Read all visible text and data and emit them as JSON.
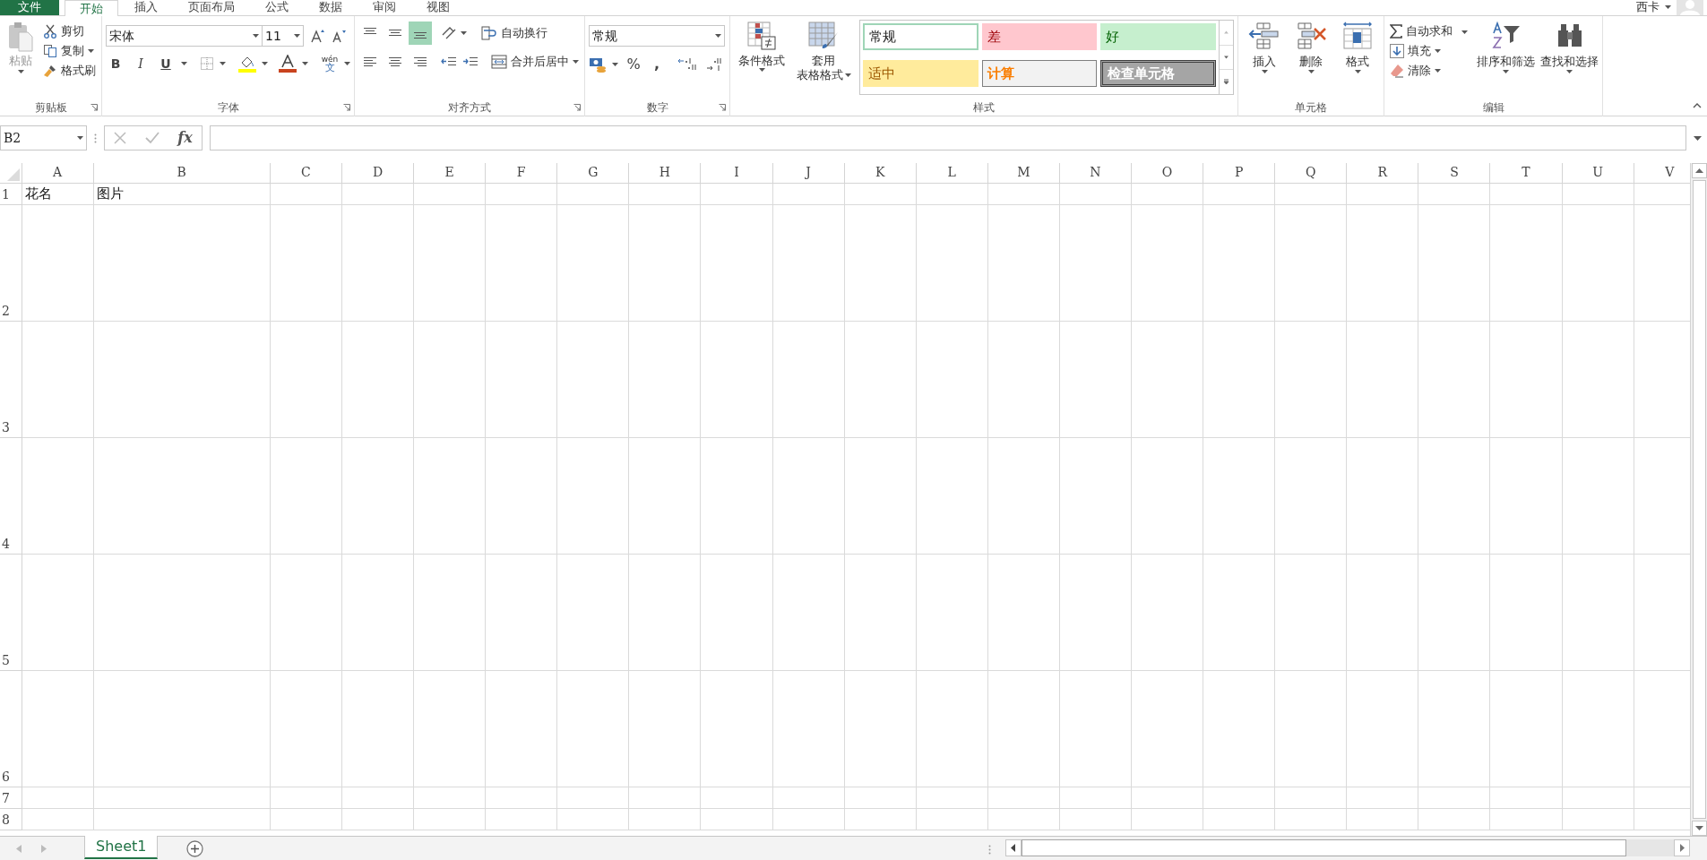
{
  "menu_tabs": [
    {
      "label": "文件",
      "kind": "file",
      "selected": false
    },
    {
      "label": "开始",
      "kind": "tab",
      "selected": true
    },
    {
      "label": "插入",
      "kind": "tab",
      "selected": false
    },
    {
      "label": "页面布局",
      "kind": "tab",
      "selected": false
    },
    {
      "label": "公式",
      "kind": "tab",
      "selected": false
    },
    {
      "label": "数据",
      "kind": "tab",
      "selected": false
    },
    {
      "label": "审阅",
      "kind": "tab",
      "selected": false
    },
    {
      "label": "视图",
      "kind": "tab",
      "selected": false
    }
  ],
  "account": {
    "name": "西卡"
  },
  "ribbon": {
    "clipboard": {
      "label": "剪贴板",
      "paste": "粘贴",
      "cut": "剪切",
      "copy": "复制",
      "format_painter": "格式刷"
    },
    "font": {
      "label": "字体",
      "font_name": "宋体",
      "font_size": "11",
      "bold": "B",
      "italic": "I",
      "underline": "U",
      "phonetic_top": "wén",
      "phonetic_bottom": "文"
    },
    "alignment": {
      "label": "对齐方式",
      "vertical_align": [
        {
          "selected": false
        },
        {
          "selected": false
        },
        {
          "selected": true
        }
      ],
      "wrap_text": "自动换行",
      "merge_center": "合并后居中"
    },
    "number": {
      "label": "数字",
      "format": "常规",
      "percent": "%",
      "comma": ","
    },
    "styles": {
      "label": "样式",
      "conditional": "条件格式",
      "table_format_top": "套用",
      "table_format_bottom": "表格格式",
      "cells": [
        {
          "label": "常规",
          "kind": "normal"
        },
        {
          "label": "差",
          "kind": "bad"
        },
        {
          "label": "好",
          "kind": "good"
        },
        {
          "label": "适中",
          "kind": "neutral"
        },
        {
          "label": "计算",
          "kind": "calc"
        },
        {
          "label": "检查单元格",
          "kind": "check"
        }
      ]
    },
    "cells": {
      "label": "单元格",
      "buttons": [
        {
          "label": "插入",
          "kind": "insert"
        },
        {
          "label": "删除",
          "kind": "delete"
        },
        {
          "label": "格式",
          "kind": "format"
        }
      ]
    },
    "editing": {
      "label": "编辑",
      "autosum": "自动求和",
      "fill": "填充",
      "clear": "清除",
      "sort_filter": "排序和筛选",
      "find_select": "查找和选择"
    }
  },
  "formula_bar": {
    "name_box": "B2",
    "fx": "fx"
  },
  "sheet": {
    "columns": [
      "A",
      "B",
      "C",
      "D",
      "E",
      "F",
      "G",
      "H",
      "I",
      "J",
      "K",
      "L",
      "M",
      "N",
      "O",
      "P",
      "Q",
      "R",
      "S",
      "T",
      "U",
      "V"
    ],
    "rows": [
      {
        "label": "1",
        "kind": "normal",
        "cells": [
          "花名",
          "图片"
        ]
      },
      {
        "label": "2",
        "kind": "tall",
        "cells": []
      },
      {
        "label": "3",
        "kind": "tall",
        "cells": []
      },
      {
        "label": "4",
        "kind": "tall",
        "cells": []
      },
      {
        "label": "5",
        "kind": "tall",
        "cells": []
      },
      {
        "label": "6",
        "kind": "tall",
        "cells": []
      },
      {
        "label": "7",
        "kind": "normal",
        "cells": []
      },
      {
        "label": "8",
        "kind": "normal",
        "cells": []
      }
    ]
  },
  "sheet_tabs": [
    {
      "label": "Sheet1",
      "selected": true
    }
  ]
}
